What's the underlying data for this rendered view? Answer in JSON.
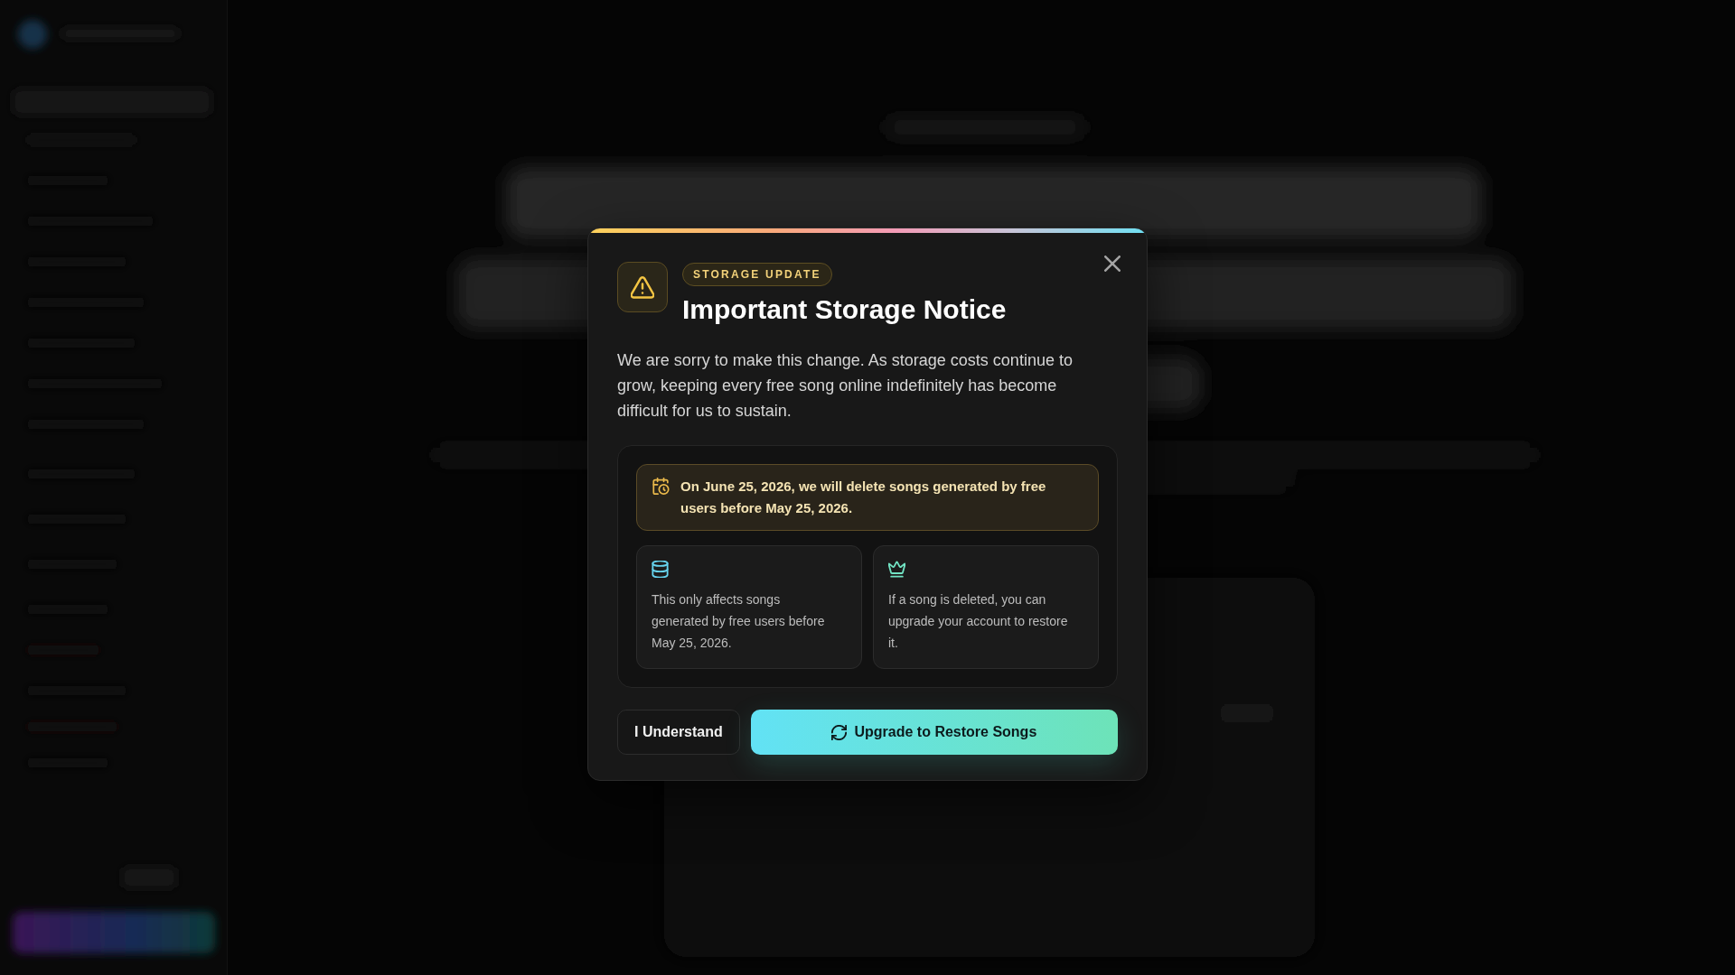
{
  "dialog": {
    "badge": "STORAGE UPDATE",
    "title": "Important Storage Notice",
    "message": "We are sorry to make this change. As storage costs continue to grow, keeping every free song online indefinitely has become difficult for us to sustain.",
    "notice": "On June 25, 2026, we will delete songs generated by free users before May 25, 2026.",
    "info_cards": [
      {
        "kind": "database",
        "text": "This only affects songs generated by free users before May 25, 2026."
      },
      {
        "kind": "crown",
        "text": "If a song is deleted, you can upgrade your account to restore it."
      }
    ],
    "buttons": [
      {
        "kind": "secondary",
        "label": "I Understand"
      },
      {
        "kind": "primary",
        "label": "Upgrade to Restore Songs"
      }
    ]
  }
}
